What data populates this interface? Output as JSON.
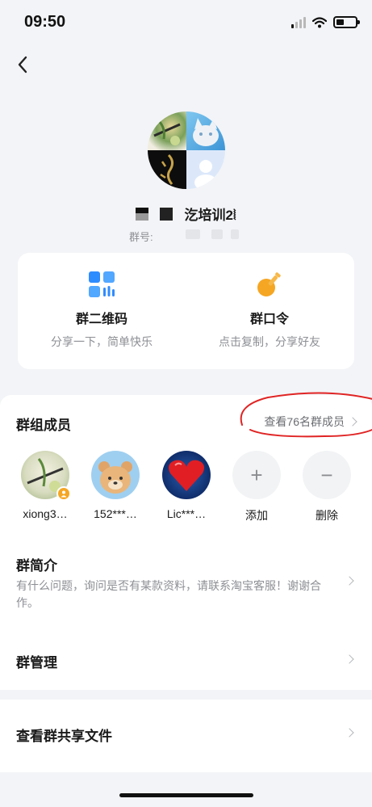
{
  "status_bar": {
    "time": "09:50"
  },
  "header": {
    "back_icon": "chevron-left-icon"
  },
  "group": {
    "name": "汔培训2⦚",
    "number_label": "群号:"
  },
  "share": {
    "qr": {
      "title": "群二维码",
      "subtitle": "分享一下，简单快乐",
      "icon": "qr-grid-icon",
      "accent": "#2f8cff"
    },
    "code": {
      "title": "群口令",
      "subtitle": "点击复制，分享好友",
      "icon": "key-icon",
      "accent": "#f5a623"
    }
  },
  "members": {
    "title": "群组成员",
    "view_all": "查看76名群成员",
    "list": [
      {
        "name": "xiong3…",
        "badge": "owner-badge-icon"
      },
      {
        "name": "152***…"
      },
      {
        "name": "Lic***…"
      }
    ],
    "add_label": "添加",
    "remove_label": "删除"
  },
  "intro": {
    "title": "群简介",
    "text": "有什么问题，询问是否有某款资料，请联系淘宝客服！谢谢合作。"
  },
  "manage": {
    "title": "群管理"
  },
  "files": {
    "title": "查看群共享文件"
  },
  "colors": {
    "background": "#f3f4f7",
    "card": "#ffffff",
    "annotation_red": "#e02424"
  }
}
